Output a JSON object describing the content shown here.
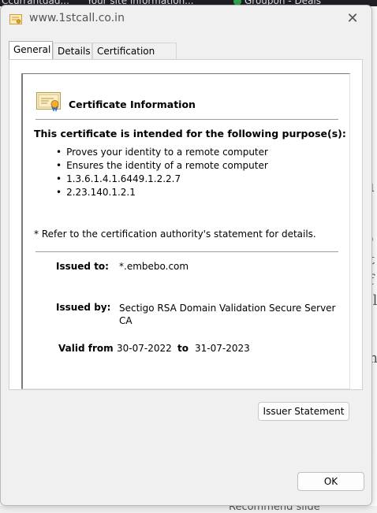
{
  "background": {
    "tabs": [
      "Ccurrantdad...",
      "Your site information...",
      "Groupon - Deals"
    ],
    "side_fragments": [
      "u",
      "b",
      "it",
      "if",
      "el",
      "m",
      "o",
      "3"
    ],
    "bottom_text": "Recommend slide"
  },
  "dialog": {
    "title": "www.1stcall.co.in",
    "close_glyph": "✕"
  },
  "tabs": [
    {
      "label": "General",
      "active": true
    },
    {
      "label": "Details",
      "active": false
    },
    {
      "label": "Certification Path",
      "active": false
    }
  ],
  "certificate": {
    "info_title": "Certificate Information",
    "purpose_heading": "This certificate is intended for the following purpose(s):",
    "purposes": [
      "Proves your identity to a remote computer",
      "Ensures the identity of a remote computer",
      "1.3.6.1.4.1.6449.1.2.2.7",
      "2.23.140.1.2.1"
    ],
    "note": "* Refer to the certification authority's statement for details.",
    "issued_to_label": "Issued to:",
    "issued_to": "*.embebo.com",
    "issued_by_label": "Issued by:",
    "issued_by": "Sectigo RSA Domain Validation Secure Server CA",
    "valid_from_label": "Valid from",
    "valid_from": "30-07-2022",
    "valid_to_label": "to",
    "valid_to": "31-07-2023"
  },
  "buttons": {
    "issuer_statement": "Issuer Statement",
    "ok": "OK"
  },
  "colors": {
    "dialog_bg": "#f0f0f0",
    "panel_bg": "#ffffff",
    "border": "#adadad"
  }
}
